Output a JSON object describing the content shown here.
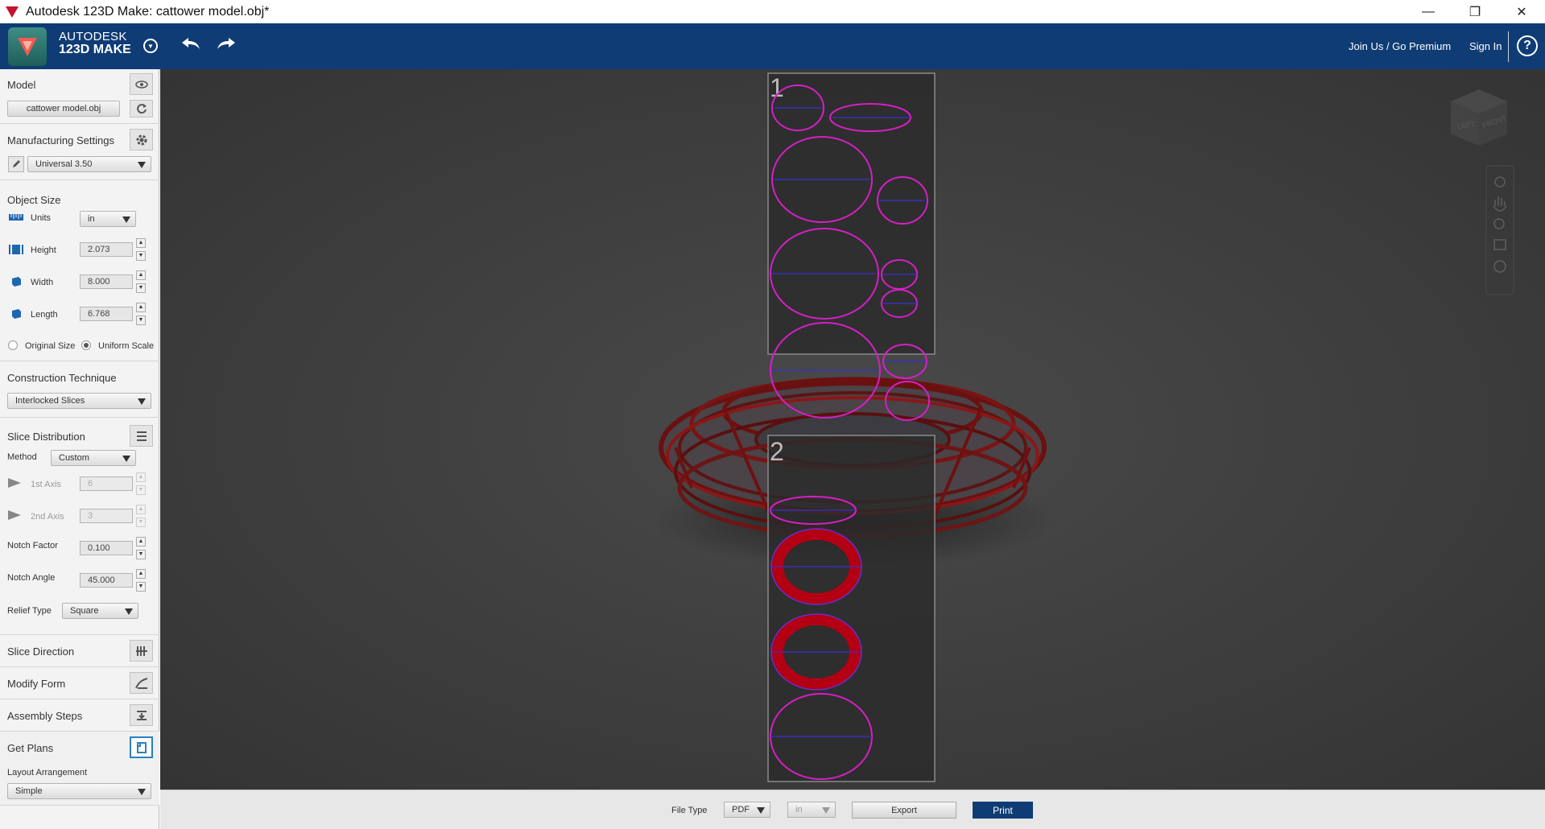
{
  "window": {
    "title": "Autodesk 123D Make: cattower model.obj*",
    "controls": [
      "—",
      "❐",
      "✕"
    ]
  },
  "header": {
    "brand_line1": "AUTODESK",
    "brand_line2": "123D MAKE",
    "join_link": "Join Us / Go Premium",
    "signin_link": "Sign In",
    "help_symbol": "?"
  },
  "sidebar": {
    "model": {
      "title": "Model",
      "file_button": "cattower model.obj"
    },
    "manufacturing": {
      "title": "Manufacturing Settings",
      "profile": "Universal 3.50"
    },
    "object_size": {
      "title": "Object Size",
      "units_label": "Units",
      "units_value": "in",
      "height_label": "Height",
      "height_value": "2.073",
      "width_label": "Width",
      "width_value": "8.000",
      "length_label": "Length",
      "length_value": "6.768",
      "original_size": "Original Size",
      "uniform_scale": "Uniform Scale"
    },
    "construction": {
      "title": "Construction Technique",
      "value": "Interlocked Slices"
    },
    "slice_distribution": {
      "title": "Slice Distribution",
      "method_label": "Method",
      "method_value": "Custom",
      "axis1_label": "1st Axis",
      "axis1_value": "6",
      "axis2_label": "2nd Axis",
      "axis2_value": "3",
      "notch_factor_label": "Notch Factor",
      "notch_factor_value": "0.100",
      "notch_angle_label": "Notch Angle",
      "notch_angle_value": "45.000",
      "relief_type_label": "Relief Type",
      "relief_type_value": "Square"
    },
    "slice_direction": {
      "title": "Slice Direction"
    },
    "modify_form": {
      "title": "Modify Form"
    },
    "assembly_steps": {
      "title": "Assembly Steps"
    },
    "get_plans": {
      "title": "Get Plans",
      "layout_label": "Layout Arrangement",
      "layout_value": "Simple"
    }
  },
  "viewport": {
    "sheets": [
      {
        "number": "1"
      },
      {
        "number": "2"
      }
    ],
    "navcube": {
      "left_face": "LEFT",
      "front_face": "FRONT"
    },
    "nav_tools": [
      "orbit-icon",
      "pan-icon",
      "zoom-icon",
      "fit-icon",
      "look-icon"
    ]
  },
  "bottombar": {
    "file_type_label": "File Type",
    "file_type_value": "PDF",
    "units_value": "in",
    "export_label": "Export",
    "print_label": "Print"
  },
  "colors": {
    "header": "#0f3c74",
    "viewport": "#3a3a3a",
    "outline": "#d61fc6",
    "slice_fill": "#b30012"
  }
}
